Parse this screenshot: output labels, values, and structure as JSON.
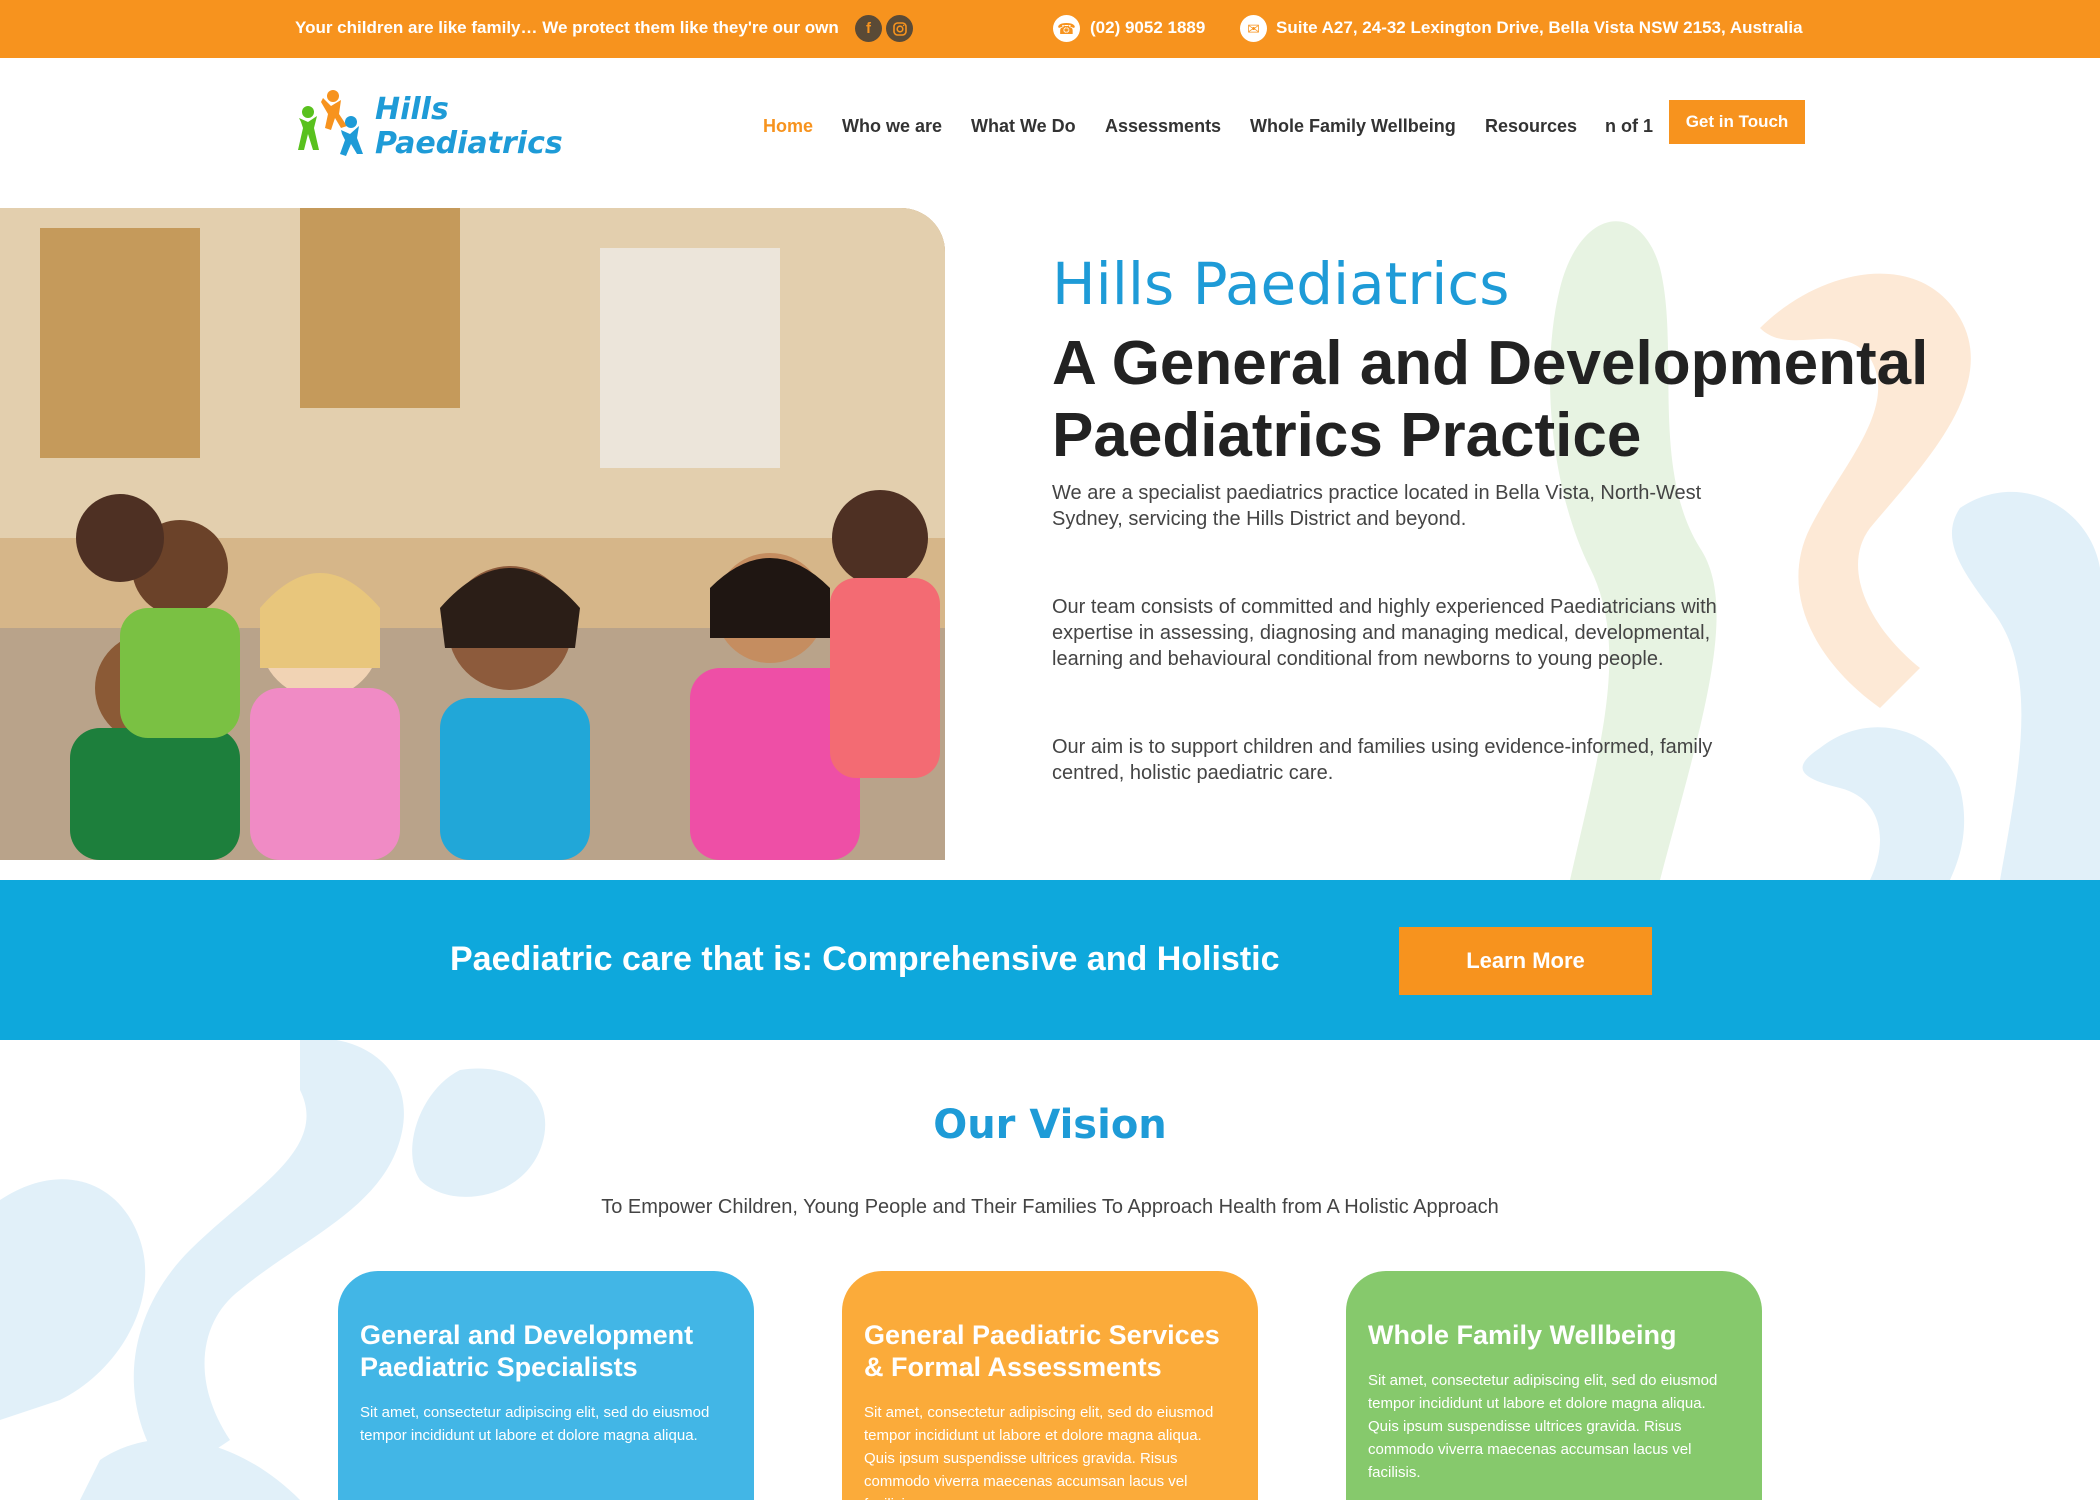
{
  "topbar": {
    "tagline": "Your children are like family… We protect them like they're our own",
    "phone": "(02) 9052 1889",
    "address": "Suite A27, 24-32 Lexington Drive, Bella Vista NSW 2153, Australia"
  },
  "logo": {
    "line1": "Hills",
    "line2": "Paediatrics"
  },
  "nav": {
    "items": [
      "Home",
      "Who we are",
      "What We Do",
      "Assessments",
      "Whole Family Wellbeing",
      "Resources",
      "n of 1"
    ],
    "cta": "Get in Touch"
  },
  "hero": {
    "brand": "Hills Paediatrics",
    "title": "A General and Developmental Paediatrics Practice",
    "paragraphs": [
      "We are a specialist paediatrics practice located in Bella Vista, North-West Sydney, servicing the Hills District and beyond.",
      "Our team consists of committed and highly experienced Paediatricians with expertise in assessing, diagnosing and managing medical, developmental, learning and behavioural conditional from newborns to young people.",
      "Our aim is to support children and families using evidence-informed, family centred, holistic paediatric care."
    ]
  },
  "banner": {
    "text": "Paediatric care that is: Comprehensive and Holistic",
    "button": "Learn More"
  },
  "vision": {
    "title": "Our Vision",
    "subtitle": "To Empower Children, Young People and Their Families To Approach Health from A Holistic Approach",
    "cards": [
      {
        "title": "General and Development Paediatric Specialists",
        "text": "Sit amet, consectetur adipiscing elit, sed do eiusmod tempor incididunt ut labore et dolore magna aliqua."
      },
      {
        "title": "General Paediatric Services & Formal Assessments",
        "text": "Sit amet, consectetur adipiscing elit, sed do eiusmod tempor incididunt ut labore et dolore magna aliqua. Quis ipsum suspendisse ultrices gravida. Risus commodo viverra maecenas accumsan lacus vel facilisis."
      },
      {
        "title": "Whole Family Wellbeing",
        "text": "Sit amet, consectetur adipiscing elit, sed do eiusmod tempor incididunt ut labore et dolore magna aliqua. Quis ipsum suspendisse ultrices gravida. Risus commodo viverra maecenas accumsan lacus vel facilisis."
      }
    ]
  },
  "icons": {
    "facebook": "facebook-icon",
    "instagram": "instagram-icon",
    "phone": "phone-icon",
    "mail": "mail-icon"
  },
  "colors": {
    "orange": "#f7931e",
    "blue": "#0ea8dc",
    "brand_blue": "#1e9bd7",
    "card_blue": "#42b6e6",
    "card_orange": "#fbab3a",
    "card_green": "#86c96c"
  }
}
